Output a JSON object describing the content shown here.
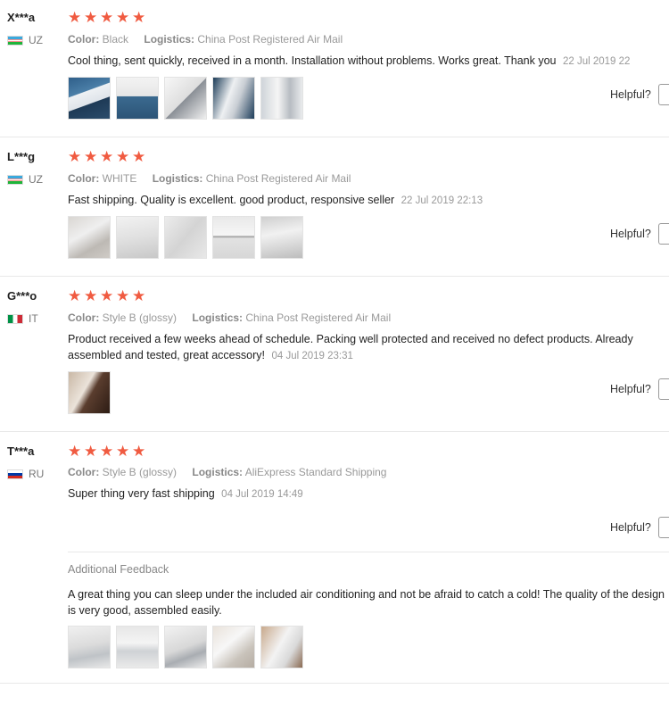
{
  "labels": {
    "color": "Color:",
    "logistics": "Logistics:",
    "helpful": "Helpful?",
    "additional_feedback": "Additional Feedback"
  },
  "colors": {
    "star": "#f05b41"
  },
  "reviews": [
    {
      "user": "X***a",
      "country": "UZ",
      "rating": 5,
      "color": "Black",
      "logistics": "China Post Registered Air Mail",
      "text": "Cool thing, sent quickly, received in a month. Installation without problems. Works great. Thank you",
      "date": "22 Jul 2019 22",
      "photos": 5
    },
    {
      "user": "L***g",
      "country": "UZ",
      "rating": 5,
      "color": "WHITE",
      "logistics": "China Post Registered Air Mail",
      "text": "Fast shipping. Quality is excellent. good product, responsive seller",
      "date": "22 Jul 2019 22:13",
      "photos": 5
    },
    {
      "user": "G***o",
      "country": "IT",
      "rating": 5,
      "color": "Style B (glossy)",
      "logistics": "China Post Registered Air Mail",
      "text": "Product received a few weeks ahead of schedule. Packing well protected and received no defect products. Already assembled and tested, great accessory!",
      "date": "04 Jul 2019 23:31",
      "photos": 1
    },
    {
      "user": "T***a",
      "country": "RU",
      "rating": 5,
      "color": "Style B (glossy)",
      "logistics": "AliExpress Standard Shipping",
      "text": "Super thing very fast shipping",
      "date": "04 Jul 2019 14:49",
      "photos": 0,
      "additional_text": "A great thing you can sleep under the included air conditioning and not be afraid to catch a cold! The quality of the design is very good, assembled easily.",
      "additional_photos": 5
    }
  ]
}
